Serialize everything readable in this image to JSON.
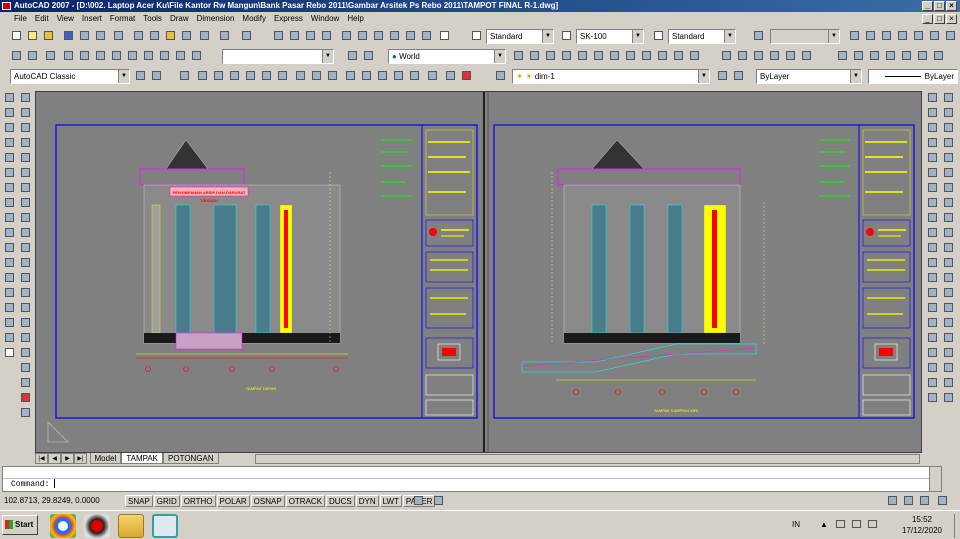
{
  "window": {
    "title": "AutoCAD 2007 - [D:\\002. Laptop Acer Ku\\File Kantor Rw Mangun\\Bank Pasar Rebo 2011\\Gambar Arsitek Ps Rebo 2011\\TAMPOT FINAL R-1.dwg]"
  },
  "menubar": {
    "items": [
      "File",
      "Edit",
      "View",
      "Insert",
      "Format",
      "Tools",
      "Draw",
      "Dimension",
      "Modify",
      "Express",
      "Window",
      "Help"
    ]
  },
  "toolbars": {
    "text_style": "Standard",
    "dim_style": "SK-100",
    "table_style": "Standard",
    "ucs": "World",
    "workspace": "AutoCAD Classic",
    "layer": "dim-1",
    "color": "ByLayer",
    "linetype": "ByLayer"
  },
  "layout_tabs": [
    "Model",
    "TAMPAK",
    "POTONGAN"
  ],
  "layout_active": "TAMPAK",
  "command": {
    "label": "Command:"
  },
  "status": {
    "coords": "102.8713, 29.8249, 0.0000",
    "toggles": [
      "SNAP",
      "GRID",
      "ORTHO",
      "POLAR",
      "OSNAP",
      "OTRACK",
      "DUCS",
      "DYN",
      "LWT",
      "PAPER"
    ]
  },
  "taskbar": {
    "start": "Start",
    "lang": "IN",
    "time": "15:52",
    "date": "17/12/2020"
  },
  "drawing": {
    "left_banner": "PENYIMPANAN ARSIP DAN DARURAT",
    "left_banner_sub": "TIERASU",
    "left_caption": "TAMPAK DEPAN",
    "right_caption": "TAMPAK SAMPING KIRI"
  },
  "colors": {
    "title_bar": "#0a246a",
    "sheet_border": "#0000ff",
    "building_glass": "#4a7d8c",
    "column_yellow": "#ffff00",
    "banner_red": "#ff0000"
  }
}
